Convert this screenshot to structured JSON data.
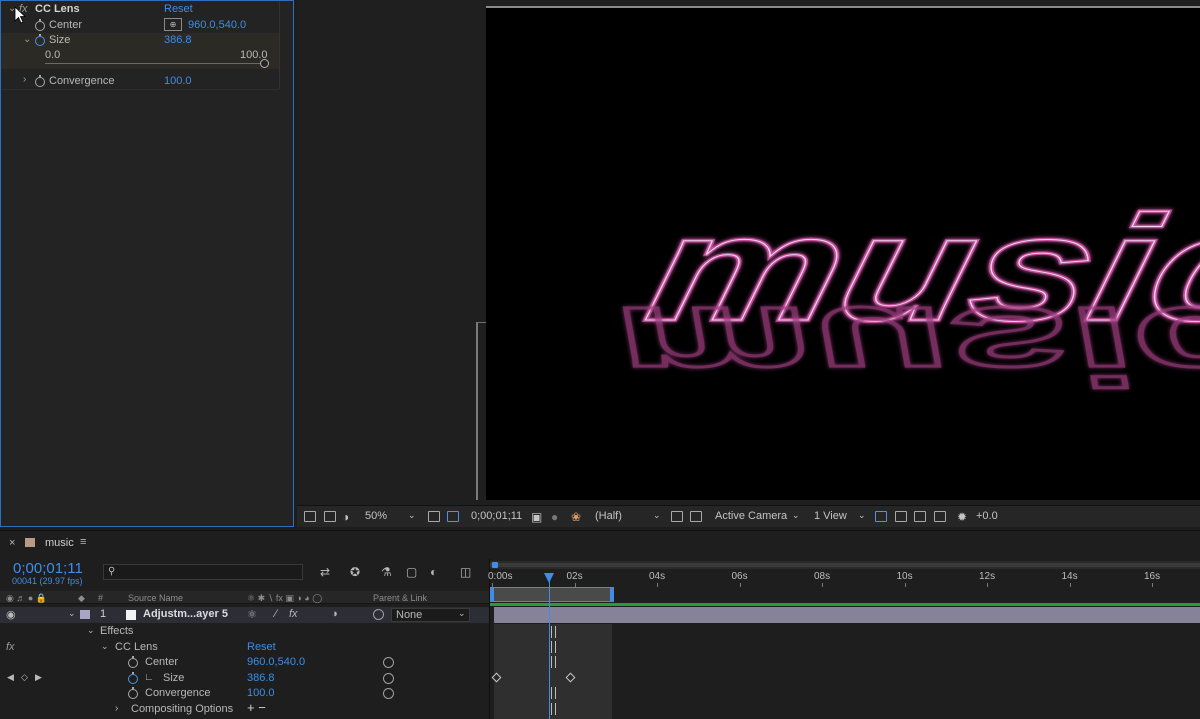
{
  "effect_controls": {
    "effect_name": "CC Lens",
    "reset_label": "Reset",
    "fx_label": "fx",
    "center": {
      "label": "Center",
      "value": "960.0,540.0"
    },
    "size": {
      "label": "Size",
      "value": "386.8",
      "slider_min": "0.0",
      "slider_max": "100.0",
      "slider_level": 1.0
    },
    "convergence": {
      "label": "Convergence",
      "value": "100.0"
    }
  },
  "viewer": {
    "comp_text": "music",
    "zoom": "50%",
    "timecode": "0;00;01;11",
    "resolution": "(Half)",
    "camera": "Active Camera",
    "views": "1 View",
    "exposure": "+0.0"
  },
  "timeline": {
    "comp_name": "music",
    "current_time": "0;00;01;11",
    "fps_info": "00041 (29.97 fps)",
    "search_placeholder": "",
    "columns": {
      "number": "#",
      "source_name": "Source Name",
      "parent_link": "Parent & Link"
    },
    "layer": {
      "index": "1",
      "name": "Adjustm...ayer 5",
      "parent": "None"
    },
    "effects_label": "Effects",
    "effect": {
      "name": "CC Lens",
      "reset_label": "Reset"
    },
    "properties": [
      {
        "label": "Center",
        "value": "960.0,540.0"
      },
      {
        "label": "Size",
        "value": "386.8"
      },
      {
        "label": "Convergence",
        "value": "100.0"
      }
    ],
    "compositing_options": "Compositing Options",
    "add_remove": "+ −",
    "ruler_ticks": [
      "0:00s",
      "02s",
      "04s",
      "06s",
      "08s",
      "10s",
      "12s",
      "14s",
      "16s"
    ],
    "playhead_seconds": 1.37
  },
  "colors": {
    "accent_blue": "#3d8ee8",
    "neon_pink": "#c24f9c",
    "panel_bg": "#232323",
    "layer_green": "#2c9a3a"
  }
}
